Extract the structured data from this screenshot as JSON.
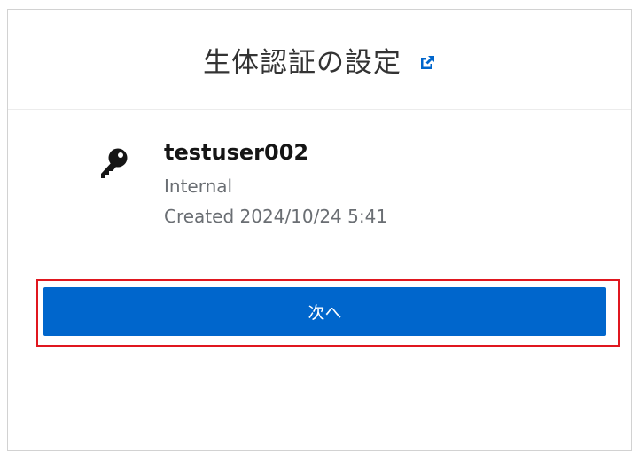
{
  "header": {
    "title": "生体認証の設定"
  },
  "credential": {
    "name": "testuser002",
    "type": "Internal",
    "created": "Created 2024/10/24 5:41"
  },
  "actions": {
    "next_label": "次へ"
  },
  "colors": {
    "primary_button": "#0066cc",
    "highlight_border": "#e0171f",
    "link_icon": "#0066cc"
  },
  "icons": {
    "external_link": "external-link-icon",
    "credential": "key-icon"
  }
}
